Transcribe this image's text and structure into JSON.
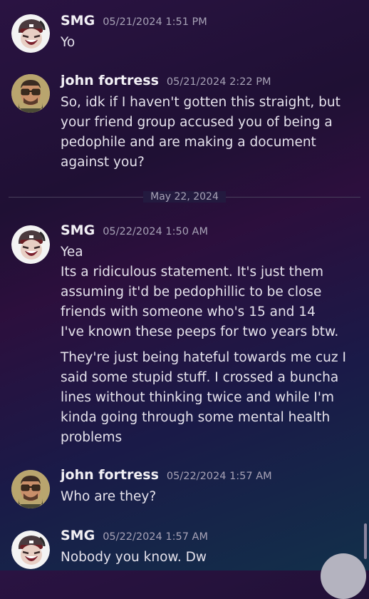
{
  "messages": [
    {
      "username": "SMG",
      "timestamp": "05/21/2024 1:51 PM",
      "lines": [
        "Yo"
      ],
      "avatar": "smg-avatar"
    },
    {
      "username": "john fortress",
      "timestamp": "05/21/2024 2:22 PM",
      "lines": [
        "So, idk if I haven't gotten this straight, but your friend group accused you of being a pedophile and are making a document against you?"
      ],
      "avatar": "john-fortress-avatar"
    },
    {
      "username": "SMG",
      "timestamp": "05/22/2024 1:50 AM",
      "lines": [
        "Yea",
        "Its a ridiculous statement. It's just them assuming it'd be pedophillic to be close friends with someone who's 15 and 14",
        "I've known these peeps for two years btw.",
        "They're just being hateful towards me cuz I said some stupid stuff. I crossed a buncha lines without thinking twice and while I'm kinda going through some mental health problems"
      ],
      "avatar": "smg-avatar"
    },
    {
      "username": "john fortress",
      "timestamp": "05/22/2024 1:57 AM",
      "lines": [
        "Who are they?"
      ],
      "avatar": "john-fortress-avatar"
    },
    {
      "username": "SMG",
      "timestamp": "05/22/2024 1:57 AM",
      "lines": [
        "Nobody you know. Dw"
      ],
      "avatar": "smg-avatar"
    }
  ],
  "divider": {
    "date": "May 22, 2024"
  },
  "colors": {
    "background_top": "#2a1342",
    "background_bottom": "#12304a",
    "username": "#f2f0f5",
    "timestamp": "#a7a2b6",
    "text": "#e5e2ec"
  }
}
